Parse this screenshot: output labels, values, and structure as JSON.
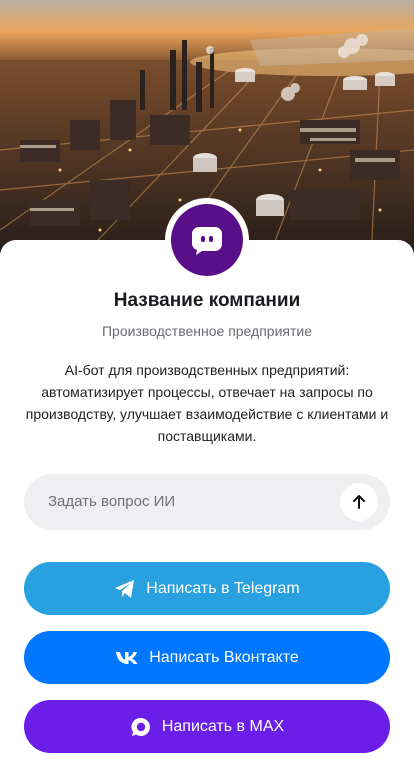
{
  "company": {
    "name": "Название компании",
    "category": "Производственное предприятие",
    "description": "AI-бот для производственных предприятий: автоматизирует процессы, отвечает на запросы по производству, улучшает взаимодействие с клиентами и поставщиками."
  },
  "ask": {
    "placeholder": "Задать вопрос ИИ"
  },
  "buttons": {
    "telegram": "Написать в Telegram",
    "vk": "Написать Вконтакте",
    "max": "Написать в MAX"
  },
  "colors": {
    "brand_avatar": "#5a0f8a",
    "telegram": "#29a1e0",
    "vk": "#0077ff",
    "max": "#6a1ee8"
  },
  "icons": {
    "avatar": "chat-bubble-icon",
    "send": "arrow-up-icon",
    "telegram": "telegram-icon",
    "vk": "vk-icon",
    "max": "max-icon"
  }
}
